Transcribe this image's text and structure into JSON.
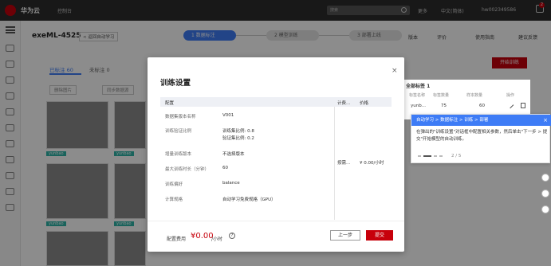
{
  "topbar": {
    "brand": "华为云",
    "console": "控制台",
    "search_placeholder": "搜索",
    "more": "更多",
    "lang": "中文(简体)",
    "user": "hw002349586",
    "badge": "2"
  },
  "project": {
    "title": "exeML-4525",
    "back": "< 返回自动学习"
  },
  "steps": [
    {
      "label": "1 数据标注"
    },
    {
      "label": "2 模型训练"
    },
    {
      "label": "3 部署上线"
    }
  ],
  "tools": {
    "version": "版本",
    "evaluate": "评价",
    "guide": "使用指南",
    "feedback": "建议反馈"
  },
  "train_button": "开始训练",
  "tabs": {
    "labeled": "已标注 60",
    "unlabeled": "未标注 0"
  },
  "toolbar": {
    "delete": "删除图片",
    "sync": "同步数据源"
  },
  "label_panel": {
    "title": "全部标签 1",
    "cols": [
      "标签名称",
      "标签数量",
      "样本数量",
      "操作"
    ],
    "row": {
      "name": "yunb...",
      "count": "75",
      "samples": "60"
    }
  },
  "image_tag": "yunbao",
  "dialog": {
    "title": "训练设置",
    "close": "×",
    "headers": {
      "config": "配置",
      "billing": "计费...",
      "price": "价格"
    },
    "rows": [
      {
        "label": "数据集版本名称",
        "value": "V001"
      },
      {
        "label": "训练验证比例",
        "value": "训练集比例: 0.8",
        "value2": "验证集比例: 0.2"
      },
      {
        "label": "增量训练版本",
        "value": "不选择版本"
      },
      {
        "label": "最大训练时长（分钟）",
        "value": "60"
      },
      {
        "label": "训练偏好",
        "value": "balance"
      },
      {
        "label": "计算规格",
        "value": "自动学习免费规格（GPU）"
      }
    ],
    "billing": "按需...",
    "price": "¥ 0.00/小时",
    "cost_label": "配置费用",
    "cost_value": "¥0.00",
    "cost_unit": "/小时",
    "prev": "上一步",
    "submit": "提交"
  },
  "tooltip": {
    "breadcrumb": "自动学习 > 数据标注 > 训练 > 部署",
    "body": "在弹出的\"训练设置\"对话框中配置相关参数，然后单击\"下一步 > 提交\"开始模型的自动训练。",
    "page": "2 / 5",
    "close": "×"
  },
  "colors": {
    "brand_red": "#c7000b",
    "accent_blue": "#3e7cf6",
    "teal": "#2fb5a8"
  }
}
